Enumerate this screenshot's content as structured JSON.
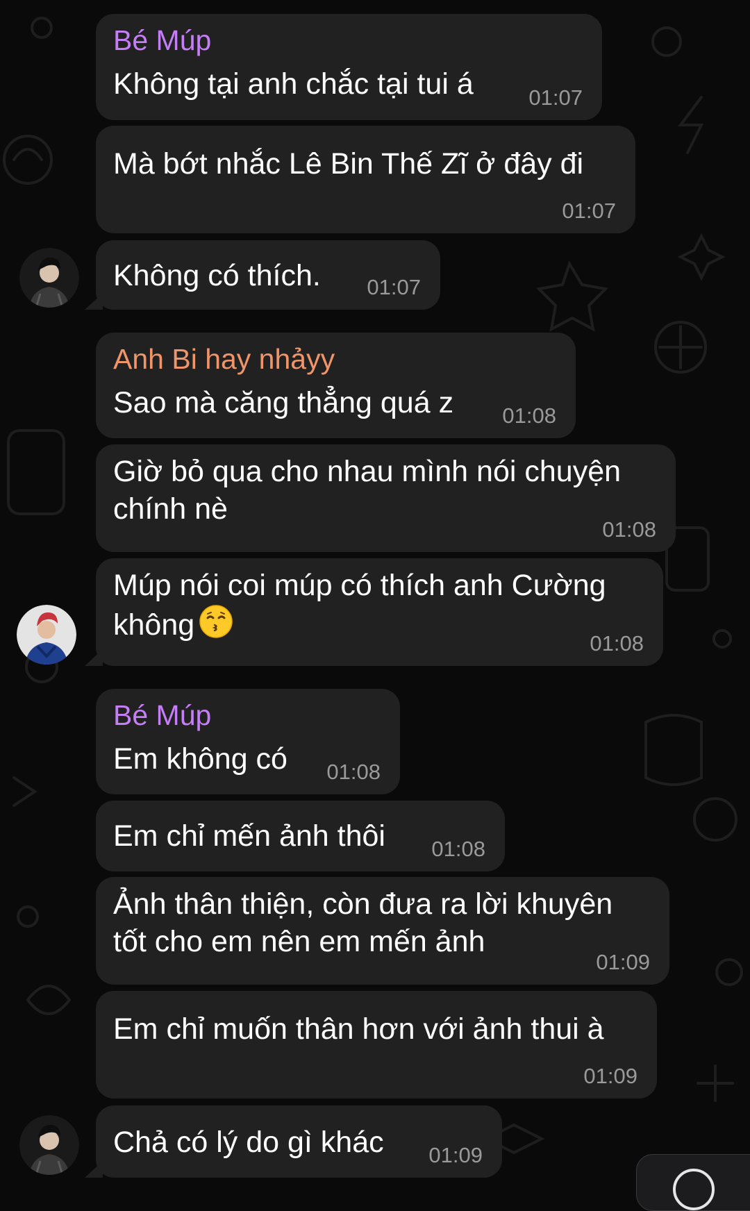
{
  "colors": {
    "background": "#0a0a0a",
    "bubble": "#212121",
    "text": "#ffffff",
    "time": "#9a9a9a",
    "sender_be_mup": "#c57ef5",
    "sender_anh_bi": "#f0956a"
  },
  "messages": [
    {
      "sender": "Bé Múp",
      "text": "Không tại anh chắc tại tui á",
      "time": "01:07"
    },
    {
      "text": "Mà bớt nhắc Lê Bin Thế Zĩ ở đây đi",
      "time": "01:07"
    },
    {
      "text": "Không có thích.",
      "time": "01:07",
      "avatar": "avatar-1-icon"
    },
    {
      "sender": "Anh Bi hay nhảyy",
      "text": "Sao mà căng thẳng quá z",
      "time": "01:08"
    },
    {
      "text_line1": "Giờ bỏ qua cho nhau mình nói chuyện",
      "text_line2": "chính nè",
      "time": "01:08"
    },
    {
      "text_line1": "Múp nói coi múp có thích anh Cường",
      "text_line2": "không",
      "emoji": "kissing-face-emoji-icon",
      "time": "01:08",
      "avatar": "avatar-2-icon"
    },
    {
      "sender": "Bé Múp",
      "text": "Em không có",
      "time": "01:08"
    },
    {
      "text": "Em chỉ mến ảnh thôi",
      "time": "01:08"
    },
    {
      "text_line1": "Ảnh thân thiện, còn đưa ra lời khuyên",
      "text_line2": "tốt cho em nên em mến ảnh",
      "time": "01:09"
    },
    {
      "text": "Em chỉ muốn thân hơn với ảnh thui à",
      "time": "01:09"
    },
    {
      "text": "Chả có lý do gì khác",
      "time": "01:09",
      "avatar": "avatar-1-icon"
    }
  ]
}
